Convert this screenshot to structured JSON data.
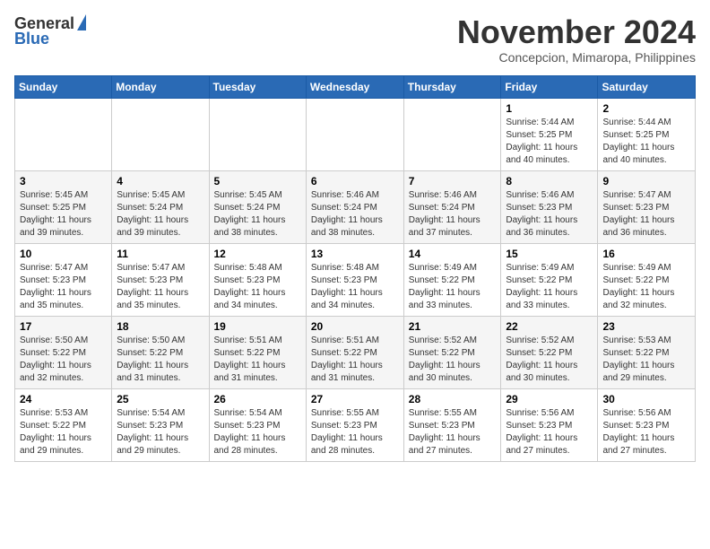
{
  "header": {
    "logo_general": "General",
    "logo_blue": "Blue",
    "month_title": "November 2024",
    "location": "Concepcion, Mimaropa, Philippines"
  },
  "calendar": {
    "weekdays": [
      "Sunday",
      "Monday",
      "Tuesday",
      "Wednesday",
      "Thursday",
      "Friday",
      "Saturday"
    ],
    "weeks": [
      [
        {
          "day": "",
          "info": ""
        },
        {
          "day": "",
          "info": ""
        },
        {
          "day": "",
          "info": ""
        },
        {
          "day": "",
          "info": ""
        },
        {
          "day": "",
          "info": ""
        },
        {
          "day": "1",
          "info": "Sunrise: 5:44 AM\nSunset: 5:25 PM\nDaylight: 11 hours and 40 minutes."
        },
        {
          "day": "2",
          "info": "Sunrise: 5:44 AM\nSunset: 5:25 PM\nDaylight: 11 hours and 40 minutes."
        }
      ],
      [
        {
          "day": "3",
          "info": "Sunrise: 5:45 AM\nSunset: 5:25 PM\nDaylight: 11 hours and 39 minutes."
        },
        {
          "day": "4",
          "info": "Sunrise: 5:45 AM\nSunset: 5:24 PM\nDaylight: 11 hours and 39 minutes."
        },
        {
          "day": "5",
          "info": "Sunrise: 5:45 AM\nSunset: 5:24 PM\nDaylight: 11 hours and 38 minutes."
        },
        {
          "day": "6",
          "info": "Sunrise: 5:46 AM\nSunset: 5:24 PM\nDaylight: 11 hours and 38 minutes."
        },
        {
          "day": "7",
          "info": "Sunrise: 5:46 AM\nSunset: 5:24 PM\nDaylight: 11 hours and 37 minutes."
        },
        {
          "day": "8",
          "info": "Sunrise: 5:46 AM\nSunset: 5:23 PM\nDaylight: 11 hours and 36 minutes."
        },
        {
          "day": "9",
          "info": "Sunrise: 5:47 AM\nSunset: 5:23 PM\nDaylight: 11 hours and 36 minutes."
        }
      ],
      [
        {
          "day": "10",
          "info": "Sunrise: 5:47 AM\nSunset: 5:23 PM\nDaylight: 11 hours and 35 minutes."
        },
        {
          "day": "11",
          "info": "Sunrise: 5:47 AM\nSunset: 5:23 PM\nDaylight: 11 hours and 35 minutes."
        },
        {
          "day": "12",
          "info": "Sunrise: 5:48 AM\nSunset: 5:23 PM\nDaylight: 11 hours and 34 minutes."
        },
        {
          "day": "13",
          "info": "Sunrise: 5:48 AM\nSunset: 5:23 PM\nDaylight: 11 hours and 34 minutes."
        },
        {
          "day": "14",
          "info": "Sunrise: 5:49 AM\nSunset: 5:22 PM\nDaylight: 11 hours and 33 minutes."
        },
        {
          "day": "15",
          "info": "Sunrise: 5:49 AM\nSunset: 5:22 PM\nDaylight: 11 hours and 33 minutes."
        },
        {
          "day": "16",
          "info": "Sunrise: 5:49 AM\nSunset: 5:22 PM\nDaylight: 11 hours and 32 minutes."
        }
      ],
      [
        {
          "day": "17",
          "info": "Sunrise: 5:50 AM\nSunset: 5:22 PM\nDaylight: 11 hours and 32 minutes."
        },
        {
          "day": "18",
          "info": "Sunrise: 5:50 AM\nSunset: 5:22 PM\nDaylight: 11 hours and 31 minutes."
        },
        {
          "day": "19",
          "info": "Sunrise: 5:51 AM\nSunset: 5:22 PM\nDaylight: 11 hours and 31 minutes."
        },
        {
          "day": "20",
          "info": "Sunrise: 5:51 AM\nSunset: 5:22 PM\nDaylight: 11 hours and 31 minutes."
        },
        {
          "day": "21",
          "info": "Sunrise: 5:52 AM\nSunset: 5:22 PM\nDaylight: 11 hours and 30 minutes."
        },
        {
          "day": "22",
          "info": "Sunrise: 5:52 AM\nSunset: 5:22 PM\nDaylight: 11 hours and 30 minutes."
        },
        {
          "day": "23",
          "info": "Sunrise: 5:53 AM\nSunset: 5:22 PM\nDaylight: 11 hours and 29 minutes."
        }
      ],
      [
        {
          "day": "24",
          "info": "Sunrise: 5:53 AM\nSunset: 5:22 PM\nDaylight: 11 hours and 29 minutes."
        },
        {
          "day": "25",
          "info": "Sunrise: 5:54 AM\nSunset: 5:23 PM\nDaylight: 11 hours and 29 minutes."
        },
        {
          "day": "26",
          "info": "Sunrise: 5:54 AM\nSunset: 5:23 PM\nDaylight: 11 hours and 28 minutes."
        },
        {
          "day": "27",
          "info": "Sunrise: 5:55 AM\nSunset: 5:23 PM\nDaylight: 11 hours and 28 minutes."
        },
        {
          "day": "28",
          "info": "Sunrise: 5:55 AM\nSunset: 5:23 PM\nDaylight: 11 hours and 27 minutes."
        },
        {
          "day": "29",
          "info": "Sunrise: 5:56 AM\nSunset: 5:23 PM\nDaylight: 11 hours and 27 minutes."
        },
        {
          "day": "30",
          "info": "Sunrise: 5:56 AM\nSunset: 5:23 PM\nDaylight: 11 hours and 27 minutes."
        }
      ]
    ]
  }
}
